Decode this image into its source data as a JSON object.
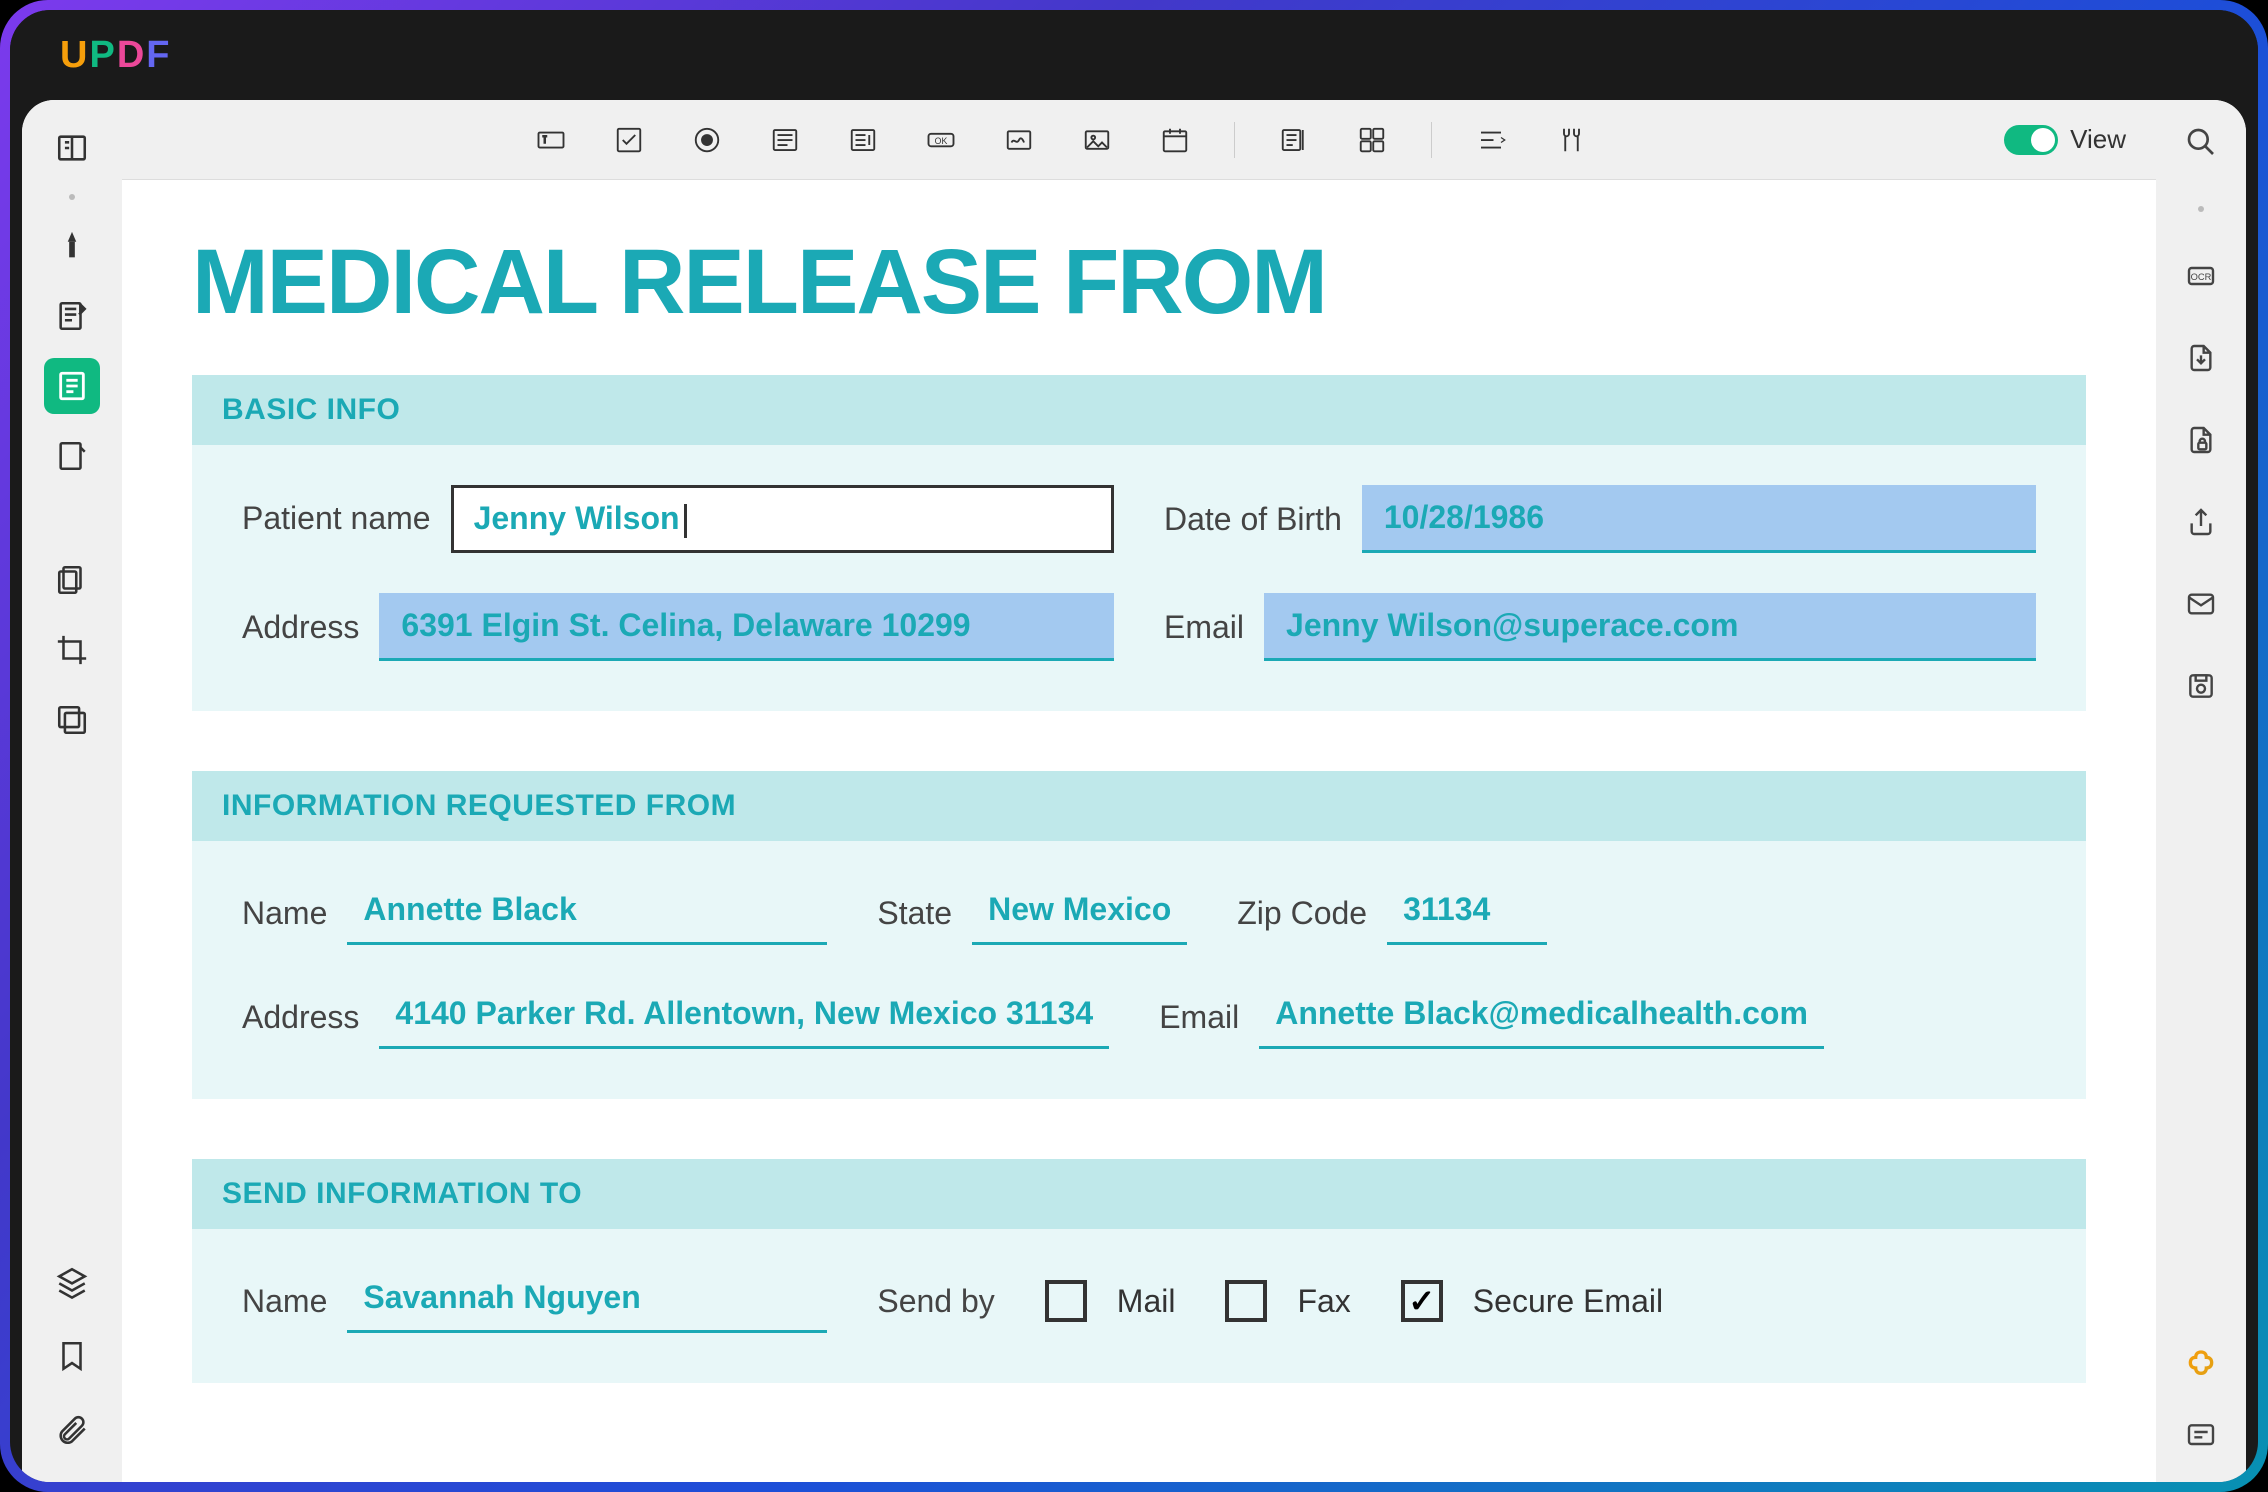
{
  "app": {
    "name": "UPDF"
  },
  "toolbar": {
    "view_label": "View"
  },
  "doc": {
    "title": "MEDICAL RELEASE FROM",
    "sections": {
      "basic": {
        "header": "BASIC INFO",
        "patient_label": "Patient name",
        "patient_value": "Jenny Wilson",
        "dob_label": "Date of Birth",
        "dob_value": "10/28/1986",
        "address_label": "Address",
        "address_value": "6391 Elgin St. Celina, Delaware 10299",
        "email_label": "Email",
        "email_value": "Jenny Wilson@superace.com"
      },
      "requested": {
        "header": "INFORMATION REQUESTED FROM",
        "name_label": "Name",
        "name_value": "Annette Black",
        "state_label": "State",
        "state_value": "New Mexico",
        "zip_label": "Zip Code",
        "zip_value": "31134",
        "address_label": "Address",
        "address_value": "4140 Parker Rd. Allentown, New Mexico 31134",
        "email_label": "Email",
        "email_value": "Annette Black@medicalhealth.com"
      },
      "send": {
        "header": "SEND INFORMATION TO",
        "name_label": "Name",
        "name_value": "Savannah Nguyen",
        "sendby_label": "Send by",
        "mail_label": "Mail",
        "fax_label": "Fax",
        "secure_label": "Secure Email",
        "mail_checked": false,
        "fax_checked": false,
        "secure_checked": true
      }
    }
  }
}
